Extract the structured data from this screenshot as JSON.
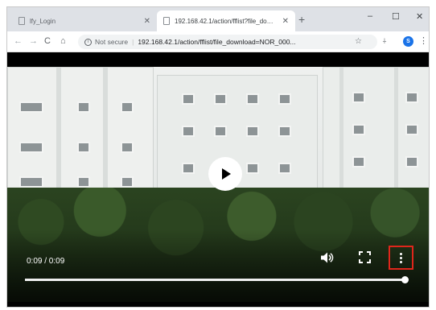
{
  "tabs": [
    {
      "title": "lfy_Login",
      "active": false
    },
    {
      "title": "192.168.42.1/action/fflist?file_download=NOR_000...",
      "active": true
    }
  ],
  "window_controls": {
    "minimize": "–",
    "maximize": "☐",
    "close": "✕"
  },
  "toolbar": {
    "back": "←",
    "forward": "→",
    "reload": "C",
    "home": "⌂",
    "security_label": "Not secure",
    "separator": "|",
    "url": "192.168.42.1/action/fflist/file_download=NOR_000..."
  },
  "icons": {
    "info": "i",
    "star": "☆",
    "extension": "⍭",
    "profile": "S",
    "menu": "⋮"
  },
  "video": {
    "time_display": "0:09 / 0:09",
    "progress": 1.0,
    "highlight_color": "#e0261b"
  }
}
